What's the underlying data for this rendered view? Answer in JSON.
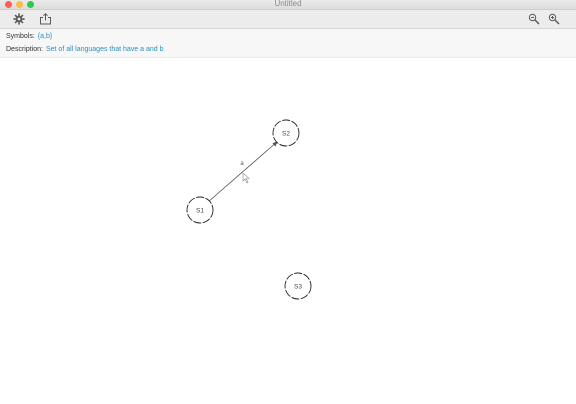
{
  "window": {
    "title": "Untitled"
  },
  "toolbar": {
    "left_buttons": [
      "gear-icon",
      "share-icon"
    ],
    "right_buttons": [
      "zoom-out-icon",
      "zoom-in-icon"
    ]
  },
  "info": {
    "symbols_label": "Symbols:",
    "symbols_value": "{a,b}",
    "description_label": "Description:",
    "description_value": "Set of all languages that have a and b"
  },
  "colors": {
    "accent": "#2a8fbd",
    "close": "#fc605b",
    "minimize": "#fdbc40",
    "zoom": "#34c84a"
  },
  "graph": {
    "states": [
      {
        "id": "S1",
        "label": "S1"
      },
      {
        "id": "S2",
        "label": "S2"
      },
      {
        "id": "S3",
        "label": "S3"
      }
    ],
    "transitions": [
      {
        "from": "S1",
        "to": "S2",
        "label": "a"
      }
    ]
  }
}
